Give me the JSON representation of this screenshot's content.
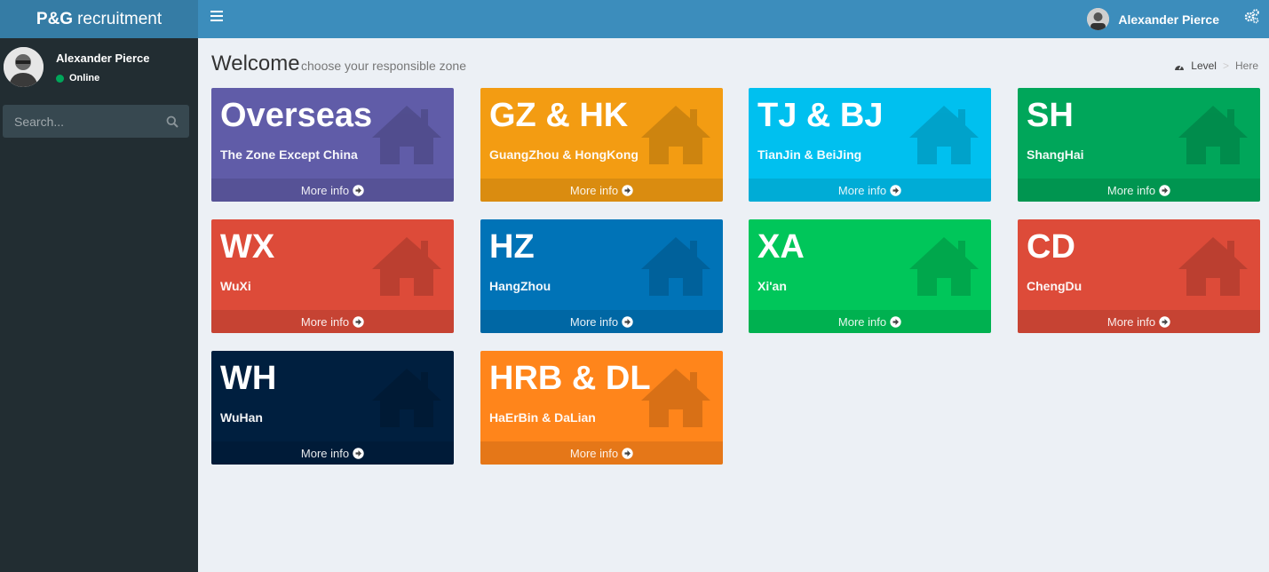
{
  "app": {
    "logo_bold": "P&G",
    "logo_rest": "recruitment"
  },
  "header": {
    "user_name": "Alexander Pierce"
  },
  "sidebar": {
    "user_name": "Alexander Pierce",
    "status": "Online",
    "search_placeholder": "Search..."
  },
  "content": {
    "title": "Welcome",
    "subtitle": "choose your responsible zone",
    "breadcrumb": [
      "Level",
      ">",
      "Here"
    ]
  },
  "zones": [
    {
      "title": "Overseas",
      "sub": "The Zone Except China",
      "footer": "More info",
      "color": "#605ca8"
    },
    {
      "title": "GZ & HK",
      "sub": "GuangZhou & HongKong",
      "footer": "More info",
      "color": "#f39c12"
    },
    {
      "title": "TJ & BJ",
      "sub": "TianJin & BeiJing",
      "footer": "More info",
      "color": "#00c0ef"
    },
    {
      "title": "SH",
      "sub": "ShangHai",
      "footer": "More info",
      "color": "#00a65a"
    },
    {
      "title": "WX",
      "sub": "WuXi",
      "footer": "More info",
      "color": "#dd4b39"
    },
    {
      "title": "HZ",
      "sub": "HangZhou",
      "footer": "More info",
      "color": "#0073b7"
    },
    {
      "title": "XA",
      "sub": "Xi'an",
      "footer": "More info",
      "color": "#00c65a"
    },
    {
      "title": "CD",
      "sub": "ChengDu",
      "footer": "More info",
      "color": "#dd4b39"
    },
    {
      "title": "WH",
      "sub": "WuHan",
      "footer": "More info",
      "color": "#001f3f"
    },
    {
      "title": "HRB & DL",
      "sub": "HaErBin & DaLian",
      "footer": "More info",
      "color": "#ff851b"
    }
  ]
}
